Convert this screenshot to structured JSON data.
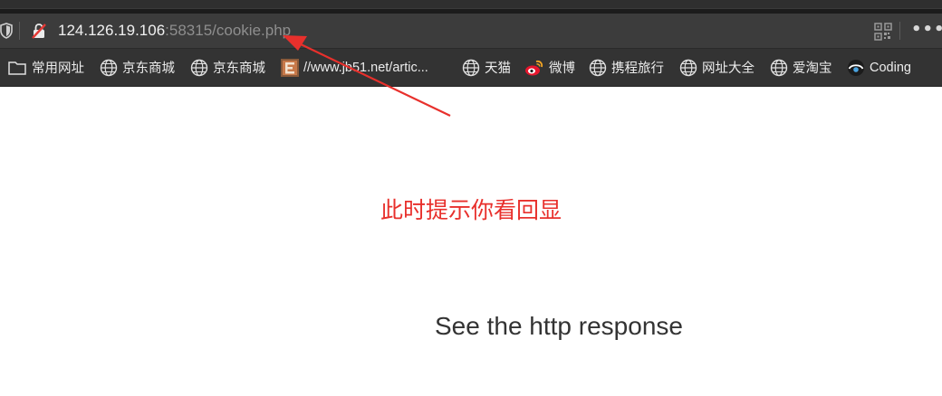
{
  "browser": {
    "url_host": "124.126.19.106",
    "url_rest": ":58315/cookie.php",
    "more_label": "•••",
    "icons": [
      "shield-icon",
      "insecure-lock-icon",
      "qr-code-icon",
      "more-icon"
    ]
  },
  "bookmarks": [
    {
      "label": "常用网址",
      "icon": "folder-icon"
    },
    {
      "label": "京东商城",
      "icon": "globe-icon"
    },
    {
      "label": "京东商城",
      "icon": "globe-icon"
    },
    {
      "label": "//www.jb51.net/artic...",
      "icon": "site-favicon-icon"
    },
    {
      "label": "天猫",
      "icon": "globe-icon"
    },
    {
      "label": "微博",
      "icon": "weibo-icon"
    },
    {
      "label": "携程旅行",
      "icon": "globe-icon"
    },
    {
      "label": "网址大全",
      "icon": "globe-icon"
    },
    {
      "label": "爱淘宝",
      "icon": "globe-icon"
    },
    {
      "label": "Coding",
      "icon": "coding-icon"
    }
  ],
  "annotation": {
    "text": "此时提示你看回显",
    "color": "#e8302c"
  },
  "page": {
    "message": "See the http response"
  }
}
